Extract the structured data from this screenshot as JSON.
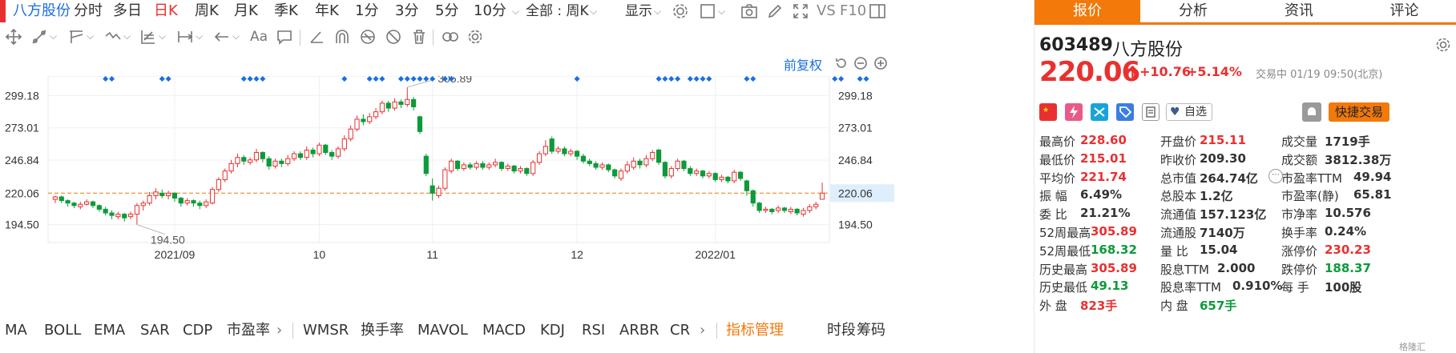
{
  "toolbar": {
    "stock_name": "八方股份",
    "periods": [
      "分时",
      "多日",
      "日K",
      "周K",
      "月K",
      "季K",
      "年K",
      "1分",
      "3分",
      "5分",
      "10分"
    ],
    "active_period": "日K",
    "all_select": "全部 : 周K",
    "display": "显示",
    "vs": "VS",
    "f10": "F10"
  },
  "draw_tools": {
    "labels": [
      "Aa"
    ],
    "icons": [
      "crosshair-icon",
      "line-tool-icon",
      "ray-tool-icon",
      "wave-tool-icon",
      "fib-tool-icon",
      "range-tool-icon",
      "arrow-tool-icon",
      "text-tool-icon",
      "comment-tool-icon",
      "angle-tool-icon",
      "arc-tool-icon",
      "cycle-tool-icon",
      "hide-tool-icon",
      "delete-tool-icon",
      "link-tool-icon",
      "settings-tool-icon"
    ]
  },
  "chart_controls": {
    "adjust": "前复权"
  },
  "chart_data": {
    "type": "candlestick",
    "price_ticks": [
      299.18,
      273.01,
      246.84,
      220.06,
      194.5
    ],
    "x_ticks": [
      "2021/09",
      "10",
      "11",
      "12",
      "2022/01"
    ],
    "ylim": [
      180,
      315
    ],
    "current_price_line": 220.06,
    "high_annotation": 305.89,
    "low_annotation": 194.5,
    "candles": [
      {
        "o": 215,
        "c": 217,
        "h": 218,
        "l": 212
      },
      {
        "o": 217,
        "c": 214,
        "h": 218,
        "l": 212
      },
      {
        "o": 214,
        "c": 212,
        "h": 215,
        "l": 209
      },
      {
        "o": 212,
        "c": 210,
        "h": 213,
        "l": 208
      },
      {
        "o": 209,
        "c": 211,
        "h": 213,
        "l": 207
      },
      {
        "o": 211,
        "c": 213,
        "h": 215,
        "l": 210
      },
      {
        "o": 213,
        "c": 210,
        "h": 214,
        "l": 208
      },
      {
        "o": 210,
        "c": 207,
        "h": 211,
        "l": 205
      },
      {
        "o": 207,
        "c": 204,
        "h": 209,
        "l": 202
      },
      {
        "o": 204,
        "c": 202,
        "h": 206,
        "l": 199
      },
      {
        "o": 201,
        "c": 203,
        "h": 205,
        "l": 199
      },
      {
        "o": 203,
        "c": 200,
        "h": 204,
        "l": 197
      },
      {
        "o": 201,
        "c": 203,
        "h": 205,
        "l": 199
      },
      {
        "o": 203,
        "c": 210,
        "h": 212,
        "l": 194.5
      },
      {
        "o": 210,
        "c": 212,
        "h": 214,
        "l": 206
      },
      {
        "o": 212,
        "c": 218,
        "h": 221,
        "l": 210
      },
      {
        "o": 218,
        "c": 221,
        "h": 224,
        "l": 215
      },
      {
        "o": 220,
        "c": 218,
        "h": 223,
        "l": 216
      },
      {
        "o": 218,
        "c": 220,
        "h": 222,
        "l": 215
      },
      {
        "o": 220,
        "c": 216,
        "h": 221,
        "l": 213
      },
      {
        "o": 216,
        "c": 212,
        "h": 217,
        "l": 209
      },
      {
        "o": 212,
        "c": 214,
        "h": 216,
        "l": 210
      },
      {
        "o": 214,
        "c": 212,
        "h": 215,
        "l": 209
      },
      {
        "o": 212,
        "c": 210,
        "h": 214,
        "l": 207
      },
      {
        "o": 210,
        "c": 213,
        "h": 215,
        "l": 208
      },
      {
        "o": 212,
        "c": 223,
        "h": 225,
        "l": 211
      },
      {
        "o": 223,
        "c": 231,
        "h": 233,
        "l": 221
      },
      {
        "o": 231,
        "c": 238,
        "h": 240,
        "l": 229
      },
      {
        "o": 238,
        "c": 244,
        "h": 247,
        "l": 236
      },
      {
        "o": 244,
        "c": 249,
        "h": 252,
        "l": 241
      },
      {
        "o": 249,
        "c": 246,
        "h": 251,
        "l": 243
      },
      {
        "o": 245,
        "c": 247,
        "h": 249,
        "l": 243
      },
      {
        "o": 247,
        "c": 253,
        "h": 256,
        "l": 245
      },
      {
        "o": 253,
        "c": 248,
        "h": 254,
        "l": 245
      },
      {
        "o": 248,
        "c": 242,
        "h": 250,
        "l": 239
      },
      {
        "o": 242,
        "c": 246,
        "h": 248,
        "l": 240
      },
      {
        "o": 246,
        "c": 244,
        "h": 248,
        "l": 241
      },
      {
        "o": 244,
        "c": 248,
        "h": 251,
        "l": 242
      },
      {
        "o": 248,
        "c": 252,
        "h": 254,
        "l": 246
      },
      {
        "o": 252,
        "c": 249,
        "h": 254,
        "l": 247
      },
      {
        "o": 249,
        "c": 255,
        "h": 258,
        "l": 247
      },
      {
        "o": 255,
        "c": 252,
        "h": 257,
        "l": 249
      },
      {
        "o": 252,
        "c": 259,
        "h": 261,
        "l": 250
      },
      {
        "o": 259,
        "c": 253,
        "h": 260,
        "l": 251
      },
      {
        "o": 253,
        "c": 250,
        "h": 255,
        "l": 247
      },
      {
        "o": 250,
        "c": 256,
        "h": 258,
        "l": 248
      },
      {
        "o": 256,
        "c": 264,
        "h": 267,
        "l": 254
      },
      {
        "o": 264,
        "c": 272,
        "h": 275,
        "l": 262
      },
      {
        "o": 272,
        "c": 280,
        "h": 283,
        "l": 270
      },
      {
        "o": 280,
        "c": 278,
        "h": 284,
        "l": 275
      },
      {
        "o": 278,
        "c": 282,
        "h": 285,
        "l": 276
      },
      {
        "o": 282,
        "c": 286,
        "h": 289,
        "l": 280
      },
      {
        "o": 286,
        "c": 293,
        "h": 295,
        "l": 284
      },
      {
        "o": 293,
        "c": 289,
        "h": 295,
        "l": 286
      },
      {
        "o": 289,
        "c": 294,
        "h": 297,
        "l": 287
      },
      {
        "o": 294,
        "c": 292,
        "h": 296,
        "l": 289
      },
      {
        "o": 292,
        "c": 296,
        "h": 305.89,
        "l": 290
      },
      {
        "o": 296,
        "c": 290,
        "h": 298,
        "l": 287
      },
      {
        "o": 282,
        "c": 270,
        "h": 283,
        "l": 268
      },
      {
        "o": 250,
        "c": 236,
        "h": 252,
        "l": 234
      },
      {
        "o": 226,
        "c": 220,
        "h": 232,
        "l": 214
      },
      {
        "o": 218,
        "c": 224,
        "h": 226,
        "l": 216
      },
      {
        "o": 224,
        "c": 239,
        "h": 241,
        "l": 222
      },
      {
        "o": 238,
        "c": 246,
        "h": 248,
        "l": 236
      },
      {
        "o": 246,
        "c": 240,
        "h": 247,
        "l": 238
      },
      {
        "o": 240,
        "c": 243,
        "h": 245,
        "l": 238
      },
      {
        "o": 243,
        "c": 241,
        "h": 245,
        "l": 239
      },
      {
        "o": 241,
        "c": 244,
        "h": 246,
        "l": 239
      },
      {
        "o": 244,
        "c": 241,
        "h": 246,
        "l": 239
      },
      {
        "o": 241,
        "c": 243,
        "h": 245,
        "l": 239
      },
      {
        "o": 243,
        "c": 245,
        "h": 248,
        "l": 241
      },
      {
        "o": 245,
        "c": 240,
        "h": 246,
        "l": 238
      },
      {
        "o": 240,
        "c": 242,
        "h": 244,
        "l": 238
      },
      {
        "o": 242,
        "c": 238,
        "h": 243,
        "l": 236
      },
      {
        "o": 238,
        "c": 240,
        "h": 242,
        "l": 236
      },
      {
        "o": 240,
        "c": 236,
        "h": 241,
        "l": 234
      },
      {
        "o": 236,
        "c": 245,
        "h": 247,
        "l": 234
      },
      {
        "o": 245,
        "c": 252,
        "h": 254,
        "l": 243
      },
      {
        "o": 252,
        "c": 258,
        "h": 263,
        "l": 250
      },
      {
        "o": 264,
        "c": 254,
        "h": 266,
        "l": 252
      },
      {
        "o": 254,
        "c": 256,
        "h": 258,
        "l": 252
      },
      {
        "o": 256,
        "c": 252,
        "h": 258,
        "l": 250
      },
      {
        "o": 252,
        "c": 254,
        "h": 256,
        "l": 250
      },
      {
        "o": 254,
        "c": 250,
        "h": 255,
        "l": 247
      },
      {
        "o": 250,
        "c": 246,
        "h": 252,
        "l": 244
      },
      {
        "o": 246,
        "c": 244,
        "h": 248,
        "l": 242
      },
      {
        "o": 244,
        "c": 241,
        "h": 246,
        "l": 239
      },
      {
        "o": 241,
        "c": 243,
        "h": 245,
        "l": 239
      },
      {
        "o": 243,
        "c": 239,
        "h": 244,
        "l": 237
      },
      {
        "o": 239,
        "c": 234,
        "h": 240,
        "l": 232
      },
      {
        "o": 232,
        "c": 238,
        "h": 240,
        "l": 230
      },
      {
        "o": 238,
        "c": 243,
        "h": 246,
        "l": 236
      },
      {
        "o": 241,
        "c": 246,
        "h": 249,
        "l": 239
      },
      {
        "o": 246,
        "c": 243,
        "h": 248,
        "l": 240
      },
      {
        "o": 243,
        "c": 248,
        "h": 251,
        "l": 241
      },
      {
        "o": 248,
        "c": 253,
        "h": 255,
        "l": 246
      },
      {
        "o": 255,
        "c": 245,
        "h": 256,
        "l": 243
      },
      {
        "o": 245,
        "c": 234,
        "h": 246,
        "l": 232
      },
      {
        "o": 234,
        "c": 240,
        "h": 242,
        "l": 232
      },
      {
        "o": 240,
        "c": 246,
        "h": 248,
        "l": 238
      },
      {
        "o": 246,
        "c": 240,
        "h": 247,
        "l": 238
      },
      {
        "o": 240,
        "c": 236,
        "h": 242,
        "l": 234
      },
      {
        "o": 236,
        "c": 238,
        "h": 240,
        "l": 234
      },
      {
        "o": 238,
        "c": 234,
        "h": 239,
        "l": 232
      },
      {
        "o": 234,
        "c": 236,
        "h": 238,
        "l": 232
      },
      {
        "o": 236,
        "c": 231,
        "h": 237,
        "l": 229
      },
      {
        "o": 231,
        "c": 233,
        "h": 235,
        "l": 229
      },
      {
        "o": 233,
        "c": 230,
        "h": 234,
        "l": 228
      },
      {
        "o": 230,
        "c": 237,
        "h": 239,
        "l": 228
      },
      {
        "o": 237,
        "c": 232,
        "h": 238,
        "l": 230
      },
      {
        "o": 230,
        "c": 222,
        "h": 231,
        "l": 218
      },
      {
        "o": 222,
        "c": 212,
        "h": 223,
        "l": 209
      },
      {
        "o": 212,
        "c": 206,
        "h": 213,
        "l": 204
      },
      {
        "o": 206,
        "c": 207,
        "h": 209,
        "l": 204
      },
      {
        "o": 207,
        "c": 205,
        "h": 208,
        "l": 203
      },
      {
        "o": 206,
        "c": 208,
        "h": 210,
        "l": 204
      },
      {
        "o": 208,
        "c": 206,
        "h": 209,
        "l": 204
      },
      {
        "o": 205,
        "c": 207,
        "h": 209,
        "l": 203
      },
      {
        "o": 207,
        "c": 204,
        "h": 208,
        "l": 202
      },
      {
        "o": 203,
        "c": 206,
        "h": 208,
        "l": 201
      },
      {
        "o": 206,
        "c": 209,
        "h": 211,
        "l": 204
      },
      {
        "o": 209,
        "c": 211,
        "h": 213,
        "l": 207
      },
      {
        "o": 215.11,
        "c": 220.06,
        "h": 228.6,
        "l": 215.01
      }
    ]
  },
  "indicators": {
    "items": [
      "MA",
      "BOLL",
      "EMA",
      "SAR",
      "CDP",
      "市盈率",
      "WMSR",
      "换手率",
      "MAVOL",
      "MACD",
      "KDJ",
      "RSI",
      "ARBR",
      "CR"
    ],
    "manage": "指标管理",
    "tail": [
      "时段",
      "筹码"
    ]
  },
  "quote": {
    "tabs": [
      "报价",
      "分析",
      "资讯",
      "评论"
    ],
    "active_tab": "报价",
    "code": "603489",
    "name": "八方股份",
    "price": "220.06",
    "change": "+10.76",
    "change_pct": "+5.14%",
    "status": "交易中 01/19 09:50(北京)",
    "watch_label": "自选",
    "trade_button": "快捷交易",
    "fields": [
      [
        {
          "k": "最高价",
          "v": "228.60",
          "c": "red"
        },
        {
          "k": "开盘价",
          "v": "215.11",
          "c": "red"
        },
        {
          "k": "成交量",
          "v": "1719手",
          "c": "dark"
        }
      ],
      [
        {
          "k": "最低价",
          "v": "215.01",
          "c": "red"
        },
        {
          "k": "昨收价",
          "v": "209.30",
          "c": "dark"
        },
        {
          "k": "成交额",
          "v": "3812.38万",
          "c": "dark"
        }
      ],
      [
        {
          "k": "平均价",
          "v": "221.74",
          "c": "red"
        },
        {
          "k": "总市值",
          "v": "264.74亿",
          "c": "dark"
        },
        {
          "k": "市盈率TTM",
          "v": "49.94",
          "c": "dark"
        }
      ],
      [
        {
          "k": "振    幅",
          "v": "6.49%",
          "c": "dark"
        },
        {
          "k": "总股本",
          "v": "1.2亿",
          "c": "dark"
        },
        {
          "k": "市盈率(静)",
          "v": "65.81",
          "c": "dark"
        }
      ],
      [
        {
          "k": "委    比",
          "v": "21.21%",
          "c": "dark"
        },
        {
          "k": "流通值",
          "v": "157.123亿",
          "c": "dark"
        },
        {
          "k": "市净率",
          "v": "10.576",
          "c": "dark"
        }
      ],
      [
        {
          "k": "52周最高",
          "v": "305.89",
          "c": "red"
        },
        {
          "k": "流通股",
          "v": "7140万",
          "c": "dark"
        },
        {
          "k": "换手率",
          "v": "0.24%",
          "c": "dark"
        }
      ],
      [
        {
          "k": "52周最低",
          "v": "168.32",
          "c": "green"
        },
        {
          "k": "量    比",
          "v": "15.04",
          "c": "dark"
        },
        {
          "k": "涨停价",
          "v": "230.23",
          "c": "red"
        }
      ],
      [
        {
          "k": "历史最高",
          "v": "305.89",
          "c": "red"
        },
        {
          "k": "股息TTM",
          "v": "2.000",
          "c": "dark"
        },
        {
          "k": "跌停价",
          "v": "188.37",
          "c": "green"
        }
      ],
      [
        {
          "k": "历史最低",
          "v": "49.13",
          "c": "green"
        },
        {
          "k": "股息率TTM",
          "v": "0.910%",
          "c": "dark"
        },
        {
          "k": "每    手",
          "v": "100股",
          "c": "dark"
        }
      ],
      [
        {
          "k": "外    盘",
          "v": "823手",
          "c": "red"
        },
        {
          "k": "内    盘",
          "v": "657手",
          "c": "green"
        },
        {
          "k": "",
          "v": "",
          "c": "dark"
        }
      ]
    ],
    "watermark": "格隆汇"
  },
  "colors": {
    "up": "#e93030",
    "down": "#0d9a3a",
    "accent": "#1a6fe0",
    "orange": "#f2790a"
  }
}
